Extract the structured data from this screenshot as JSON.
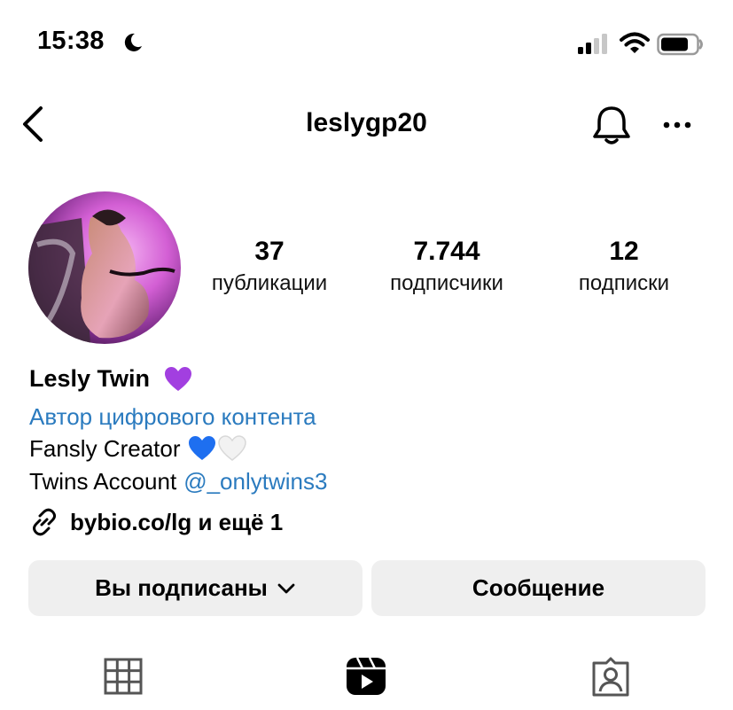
{
  "status_bar": {
    "time": "15:38"
  },
  "header": {
    "username": "leslygp20"
  },
  "stats": [
    {
      "value": "37",
      "label": "публикации"
    },
    {
      "value": "7.744",
      "label": "подписчики"
    },
    {
      "value": "12",
      "label": "подписки"
    }
  ],
  "bio": {
    "name": "Lesly Twin",
    "category": "Автор цифрового контента",
    "line1": "Fansly Creator",
    "line2_text": "Twins Account",
    "line2_mention": "@_onlytwins3",
    "link": "bybio.co/lg и ещё 1"
  },
  "buttons": {
    "follow": "Вы подписаны",
    "message": "Сообщение"
  },
  "colors": {
    "link_blue": "#2b7bbf",
    "button_bg": "#efefef",
    "heart_purple": "#a23fe0",
    "heart_blue": "#1e6ff0"
  },
  "icons": [
    "moon-icon",
    "signal-icon",
    "wifi-icon",
    "battery-icon",
    "back-icon",
    "bell-icon",
    "more-icon",
    "link-icon",
    "chevron-down-icon",
    "grid-icon",
    "reels-icon",
    "tagged-icon"
  ]
}
